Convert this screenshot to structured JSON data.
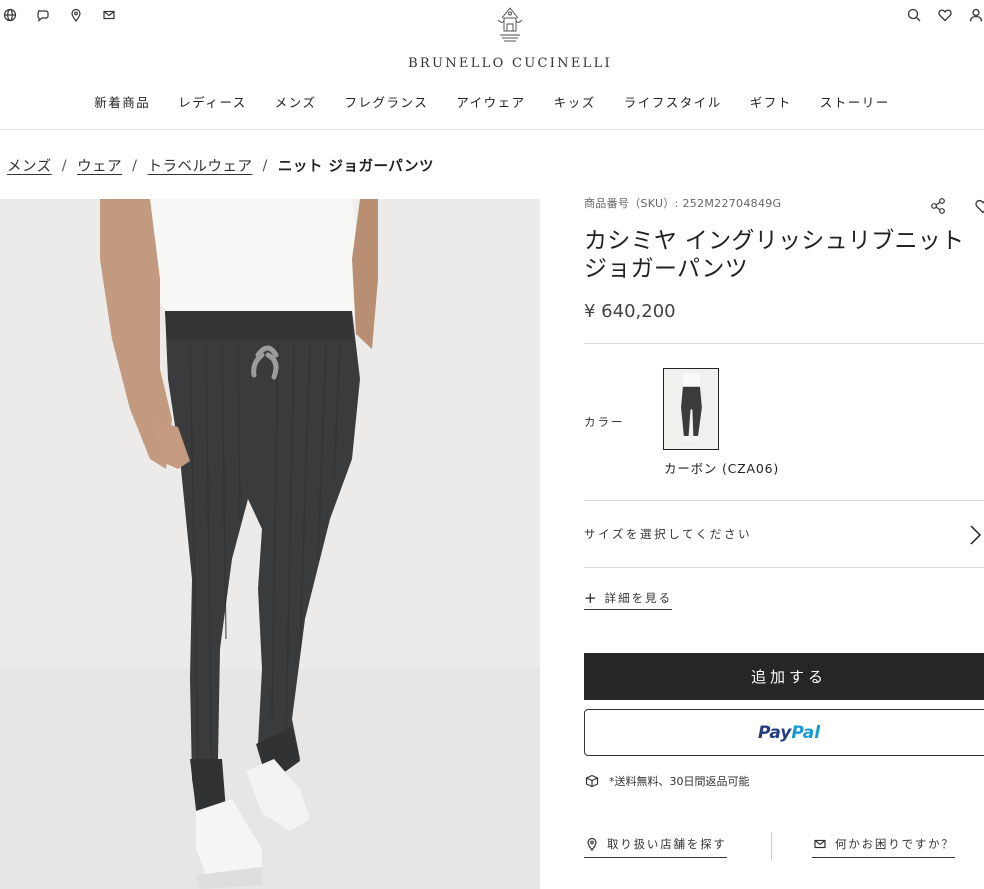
{
  "header": {
    "brand": "BRUNELLO CUCINELLI",
    "util_left_icons": [
      "globe-icon",
      "chat-icon",
      "location-icon",
      "mail-icon"
    ],
    "util_right_icons": [
      "search-icon",
      "heart-icon",
      "user-icon"
    ]
  },
  "nav": {
    "items": [
      "新着商品",
      "レディース",
      "メンズ",
      "フレグランス",
      "アイウェア",
      "キッズ",
      "ライフスタイル",
      "ギフト",
      "ストーリー"
    ]
  },
  "breadcrumb": {
    "items": [
      "メンズ",
      "ウェア",
      "トラベルウェア"
    ],
    "current": "ニット ジョガーパンツ",
    "separator": "/"
  },
  "product": {
    "sku_label": "商品番号（SKU）:",
    "sku": "252M22704849G",
    "title_line1": "カシミヤ イングリッシュリブニット",
    "title_line2": "ジョガーパンツ",
    "price": "¥ 640,200",
    "color_label": "カラー",
    "color_name": "カーボン (CZA06)",
    "size_label": "サイズを選択してください",
    "details_label": "詳細を見る",
    "add_label": "追加する",
    "paypal_a": "Pay",
    "paypal_b": "Pal",
    "shipping_note": "*送料無料、30日間返品可能",
    "store_label": "取り扱い店舗を探す",
    "help_label": "何かお困りですか？"
  },
  "colors": {
    "button_dark": "#262626",
    "paypal_dark": "#253b80",
    "paypal_light": "#179bd7",
    "image_bg": "#ecebea",
    "pants": "#3a3b3d"
  }
}
